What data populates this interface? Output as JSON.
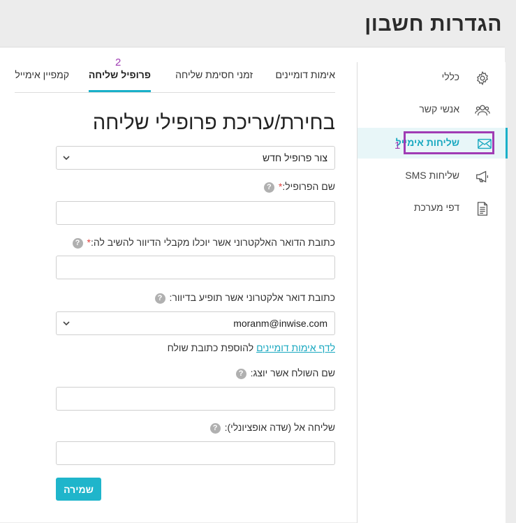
{
  "page": {
    "title": "הגדרות חשבון"
  },
  "sidebar": {
    "items": [
      {
        "label": "כללי",
        "icon": "gear-icon"
      },
      {
        "label": "אנשי קשר",
        "icon": "contacts-icon"
      },
      {
        "label": "שליחות אימייל",
        "icon": "envelope-icon",
        "active": true
      },
      {
        "label": "שליחות SMS",
        "icon": "megaphone-icon"
      },
      {
        "label": "דפי מערכת",
        "icon": "document-icon"
      }
    ]
  },
  "markers": {
    "one": "1",
    "two": "2"
  },
  "tabs": [
    {
      "label": "אימות דומיינים"
    },
    {
      "label": "זמני חסימת שליחה"
    },
    {
      "label": "פרופיל שליחה",
      "active": true
    },
    {
      "label": "קמפיין אימייל"
    }
  ],
  "form": {
    "title": "בחירת/עריכת פרופילי שליחה",
    "profile_select": "צור פרופיל חדש",
    "profile_name_label": "שם הפרופיל:",
    "reply_to_label": "כתובת הדואר האלקטרוני אשר יוכלו מקבלי הדיוור להשיב לה:",
    "required_mark": "*",
    "from_email_label": "כתובת דואר אלקטרוני אשר תופיע בדיוור:",
    "from_email_value": "moranm@inwise.com",
    "domains_link": "לדף אימות דומיינים",
    "domains_link_suffix": "להוספת כתובת שולח",
    "sender_name_label": "שם השולח אשר יוצג:",
    "send_to_label": "שליחה אל (שדה אופציונלי):",
    "help_glyph": "?",
    "save_label": "שמירה"
  },
  "colors": {
    "accent": "#1fb5cb",
    "highlight": "#a03cb4",
    "required": "#e0403c"
  }
}
